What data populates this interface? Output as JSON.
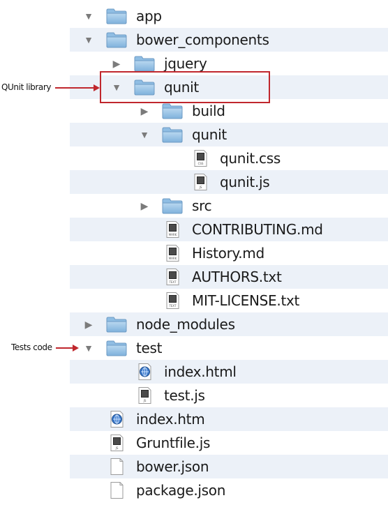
{
  "annotations": {
    "qunit_library": "QUnit library",
    "tests_code": "Tests code",
    "accent_color": "#c0272d"
  },
  "tree": [
    {
      "label": "app",
      "type": "folder",
      "level": 0,
      "expanded": true
    },
    {
      "label": "bower_components",
      "type": "folder",
      "level": 0,
      "expanded": true
    },
    {
      "label": "jquery",
      "type": "folder",
      "level": 1,
      "expanded": false
    },
    {
      "label": "qunit",
      "type": "folder",
      "level": 1,
      "expanded": true
    },
    {
      "label": "build",
      "type": "folder",
      "level": 2,
      "expanded": false
    },
    {
      "label": "qunit",
      "type": "folder",
      "level": 2,
      "expanded": true
    },
    {
      "label": "qunit.css",
      "type": "file",
      "level": 3,
      "badge": "CSS"
    },
    {
      "label": "qunit.js",
      "type": "file",
      "level": 3,
      "badge": "JS"
    },
    {
      "label": "src",
      "type": "folder",
      "level": 2,
      "expanded": false
    },
    {
      "label": "CONTRIBUTING.md",
      "type": "file",
      "level": 2,
      "badge": "MARK"
    },
    {
      "label": "History.md",
      "type": "file",
      "level": 2,
      "badge": "MARK"
    },
    {
      "label": "AUTHORS.txt",
      "type": "file",
      "level": 2,
      "badge": "TEXT"
    },
    {
      "label": "MIT-LICENSE.txt",
      "type": "file",
      "level": 2,
      "badge": "TEXT"
    },
    {
      "label": "node_modules",
      "type": "folder",
      "level": 0,
      "expanded": false
    },
    {
      "label": "test",
      "type": "folder",
      "level": 0,
      "expanded": true
    },
    {
      "label": "index.html",
      "type": "html",
      "level": 1
    },
    {
      "label": "test.js",
      "type": "file",
      "level": 1,
      "badge": "JS"
    },
    {
      "label": "index.htm",
      "type": "html",
      "level": 0
    },
    {
      "label": "Gruntfile.js",
      "type": "file",
      "level": 0,
      "badge": "JS"
    },
    {
      "label": "bower.json",
      "type": "blank",
      "level": 0
    },
    {
      "label": "package.json",
      "type": "blank",
      "level": 0
    }
  ]
}
